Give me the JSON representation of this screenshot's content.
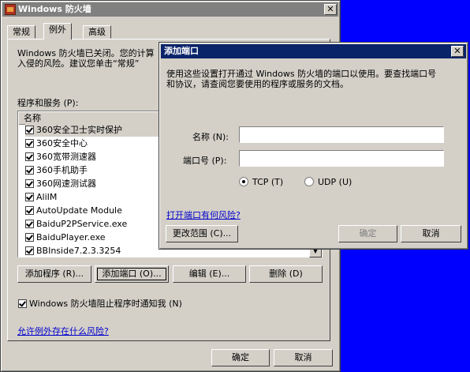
{
  "main": {
    "title": "Windows 防火墙",
    "close_label": "✕",
    "tabs": [
      {
        "label": "常规"
      },
      {
        "label": "例外"
      },
      {
        "label": "高级"
      }
    ],
    "intro_line1": "Windows 防火墙已关闭。您的计算",
    "intro_line2": "入侵的风险。建议您单击“常规”",
    "list_label": "程序和服务 (P):",
    "list_header": "名称",
    "programs": [
      {
        "name": "360安全卫士实时保护",
        "checked": true
      },
      {
        "name": "360安全中心",
        "checked": true
      },
      {
        "name": "360宽带测速器",
        "checked": true
      },
      {
        "name": "360手机助手",
        "checked": true
      },
      {
        "name": "360网速测试器",
        "checked": true
      },
      {
        "name": "AliIM",
        "checked": true
      },
      {
        "name": "AutoUpdate Module",
        "checked": true
      },
      {
        "name": "BaiduP2PService.exe",
        "checked": true
      },
      {
        "name": "BaiduPlayer.exe",
        "checked": true
      },
      {
        "name": "BBInside7.2.3.3254",
        "checked": true
      }
    ],
    "scroll_down": "▼",
    "buttons": {
      "add_program": "添加程序 (R)...",
      "add_port": "添加端口 (O)...",
      "edit": "编辑 (E)...",
      "delete": "删除 (D)"
    },
    "notify_label": "Windows 防火墙阻止程序时通知我 (N)",
    "notify_checked": true,
    "risk_link": "允许例外存在什么风险?",
    "ok": "确定",
    "cancel": "取消"
  },
  "dialog": {
    "title": "添加端口",
    "close_label": "✕",
    "desc_line1": "使用这些设置打开通过 Windows 防火墙的端口以使用。要查找端口号",
    "desc_line2": "和协议，请查阅您要使用的程序或服务的文档。",
    "name_label": "名称 (N):",
    "name_value": "",
    "port_label": "端口号 (P):",
    "port_value": "",
    "tcp_label": "TCP (T)",
    "udp_label": "UDP (U)",
    "protocol_selected": "TCP",
    "risk_link": "打开端口有何风险?",
    "change_scope": "更改范围 (C)...",
    "ok": "确定",
    "cancel": "取消"
  },
  "colors": {
    "desktop": "#0000ff",
    "dialog_titlebar": "#0a246a",
    "inactive_titlebar": "#808080",
    "face": "#d4d0c8",
    "link": "#0000cc"
  }
}
